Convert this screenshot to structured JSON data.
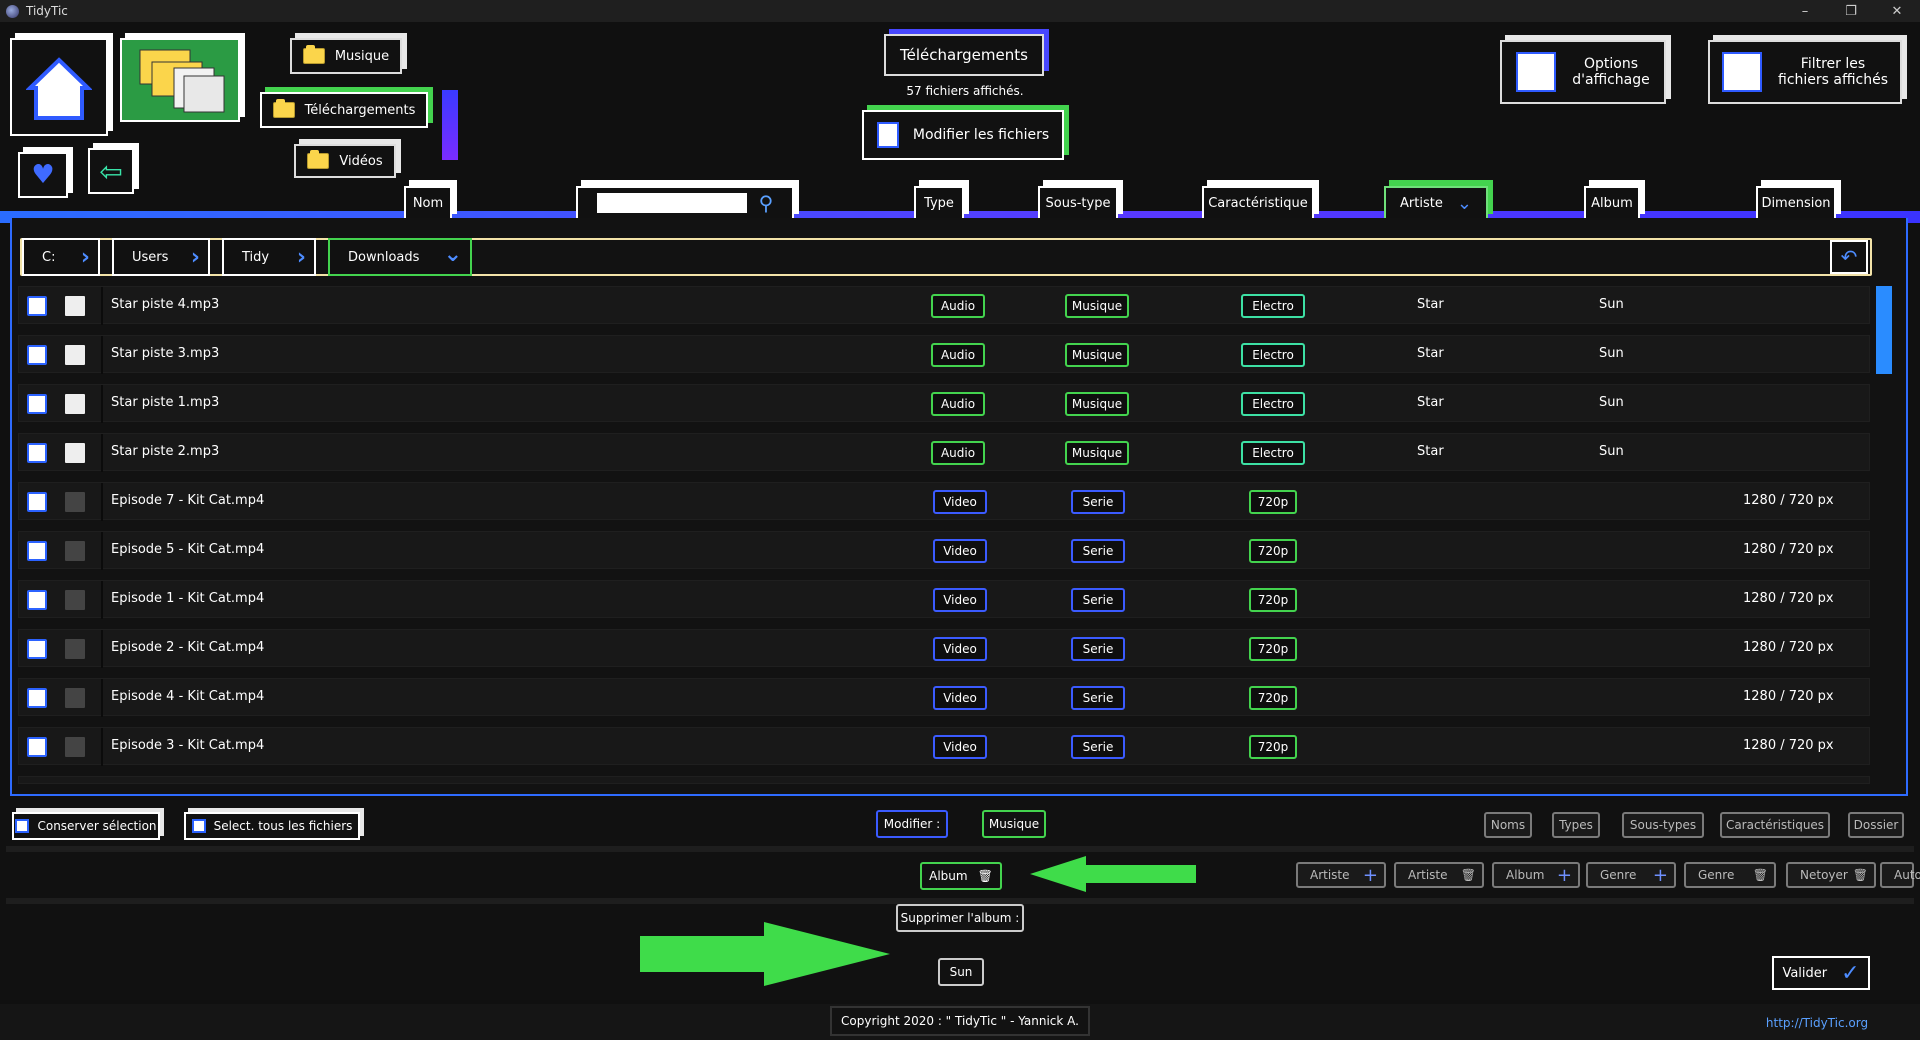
{
  "app": {
    "title": "TidyTic"
  },
  "window": {
    "minimize": "–",
    "restore": "❐",
    "close": "✕"
  },
  "nav": {
    "musique": "Musique",
    "telechargements": "Téléchargements",
    "videos": "Vidéos"
  },
  "current": {
    "folder": "Téléchargements",
    "count": "57 fichiers affichés.",
    "modify_files": "Modifier les fichiers"
  },
  "options": {
    "display": "Options\nd'affichage",
    "filter": "Filtrer les\nfichiers affichés"
  },
  "columns": {
    "nom": "Nom",
    "type": "Type",
    "soustype": "Sous-type",
    "caracteristique": "Caractéristique",
    "artiste": "Artiste",
    "album": "Album",
    "dimension": "Dimension"
  },
  "search": {
    "value": ""
  },
  "breadcrumb": [
    "C:",
    "Users",
    "Tidy",
    "Downloads"
  ],
  "files": [
    {
      "name": "Star piste 4.mp3",
      "type": "Audio",
      "subtype": "Musique",
      "carac": "Electro",
      "artist": "Star",
      "album": "Sun",
      "dim": ""
    },
    {
      "name": "Star piste 3.mp3",
      "type": "Audio",
      "subtype": "Musique",
      "carac": "Electro",
      "artist": "Star",
      "album": "Sun",
      "dim": ""
    },
    {
      "name": "Star piste 1.mp3",
      "type": "Audio",
      "subtype": "Musique",
      "carac": "Electro",
      "artist": "Star",
      "album": "Sun",
      "dim": ""
    },
    {
      "name": "Star piste 2.mp3",
      "type": "Audio",
      "subtype": "Musique",
      "carac": "Electro",
      "artist": "Star",
      "album": "Sun",
      "dim": ""
    },
    {
      "name": "Episode 7 - Kit Cat.mp4",
      "type": "Video",
      "subtype": "Serie",
      "carac": "720p",
      "artist": "",
      "album": "",
      "dim": "1280 / 720 px"
    },
    {
      "name": "Episode 5 - Kit Cat.mp4",
      "type": "Video",
      "subtype": "Serie",
      "carac": "720p",
      "artist": "",
      "album": "",
      "dim": "1280 / 720 px"
    },
    {
      "name": "Episode 1 - Kit Cat.mp4",
      "type": "Video",
      "subtype": "Serie",
      "carac": "720p",
      "artist": "",
      "album": "",
      "dim": "1280 / 720 px"
    },
    {
      "name": "Episode 2 - Kit Cat.mp4",
      "type": "Video",
      "subtype": "Serie",
      "carac": "720p",
      "artist": "",
      "album": "",
      "dim": "1280 / 720 px"
    },
    {
      "name": "Episode 4 - Kit Cat.mp4",
      "type": "Video",
      "subtype": "Serie",
      "carac": "720p",
      "artist": "",
      "album": "",
      "dim": "1280 / 720 px"
    },
    {
      "name": "Episode 3 - Kit Cat.mp4",
      "type": "Video",
      "subtype": "Serie",
      "carac": "720p",
      "artist": "",
      "album": "",
      "dim": "1280 / 720 px"
    }
  ],
  "actions": {
    "keep": "Conserver sélection",
    "select_all": "Select. tous les fichiers",
    "modify": "Modifier :",
    "mode": "Musique",
    "album": "Album",
    "delete_album": "Supprimer l'album :",
    "album_value": "Sun",
    "validate": "Valider"
  },
  "toggles": [
    "Noms",
    "Types",
    "Sous-types",
    "Caractéristiques",
    "Dossier"
  ],
  "tools": [
    "Artiste",
    "Artiste",
    "Album",
    "Genre",
    "Genre",
    "Netoyer",
    "Auto"
  ],
  "footer": {
    "copyright": "Copyright 2020 : \" TidyTic \" - Yannick A.",
    "url": "http://TidyTic.org"
  },
  "colors": {
    "accent_green": "#43d34e",
    "accent_blue": "#2e6bff",
    "arrow_green": "#3fdc4a"
  }
}
